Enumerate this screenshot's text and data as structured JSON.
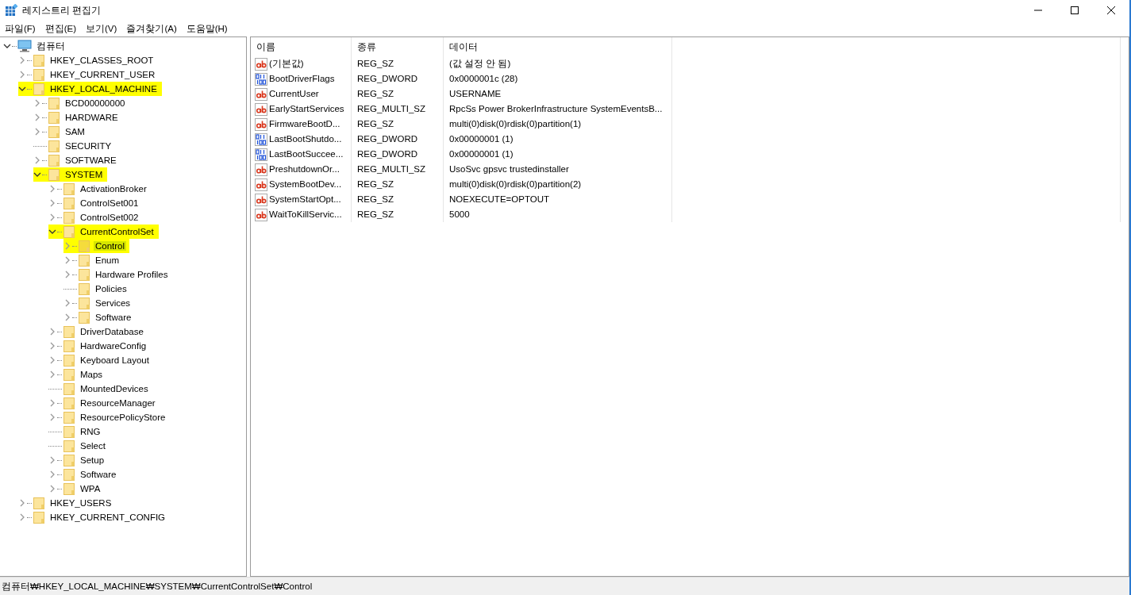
{
  "window": {
    "title": "레지스트리 편집기"
  },
  "menu": [
    "파일(F)",
    "편집(E)",
    "보기(V)",
    "즐겨찾기(A)",
    "도움말(H)"
  ],
  "tree": {
    "label": "컴퓨터",
    "kind": "computer",
    "expanded": true,
    "has_children": true,
    "highlighted": false,
    "selected": false,
    "children": [
      {
        "label": "HKEY_CLASSES_ROOT",
        "has_children": true,
        "highlighted": false,
        "selected": false
      },
      {
        "label": "HKEY_CURRENT_USER",
        "has_children": true,
        "highlighted": false,
        "selected": false
      },
      {
        "label": "HKEY_LOCAL_MACHINE",
        "has_children": true,
        "expanded": true,
        "highlighted": true,
        "selected": false,
        "children": [
          {
            "label": "BCD00000000",
            "has_children": true,
            "highlighted": false,
            "selected": false
          },
          {
            "label": "HARDWARE",
            "has_children": true,
            "highlighted": false,
            "selected": false
          },
          {
            "label": "SAM",
            "has_children": true,
            "highlighted": false,
            "selected": false
          },
          {
            "label": "SECURITY",
            "has_children": false,
            "highlighted": false,
            "selected": false
          },
          {
            "label": "SOFTWARE",
            "has_children": true,
            "highlighted": false,
            "selected": false
          },
          {
            "label": "SYSTEM",
            "has_children": true,
            "expanded": true,
            "highlighted": true,
            "selected": false,
            "children": [
              {
                "label": "ActivationBroker",
                "has_children": true,
                "highlighted": false,
                "selected": false
              },
              {
                "label": "ControlSet001",
                "has_children": true,
                "highlighted": false,
                "selected": false
              },
              {
                "label": "ControlSet002",
                "has_children": true,
                "highlighted": false,
                "selected": false
              },
              {
                "label": "CurrentControlSet",
                "has_children": true,
                "expanded": true,
                "highlighted": true,
                "selected": false,
                "children": [
                  {
                    "label": "Control",
                    "has_children": true,
                    "highlighted": true,
                    "selected": true
                  },
                  {
                    "label": "Enum",
                    "has_children": true,
                    "highlighted": false,
                    "selected": false
                  },
                  {
                    "label": "Hardware Profiles",
                    "has_children": true,
                    "highlighted": false,
                    "selected": false
                  },
                  {
                    "label": "Policies",
                    "has_children": false,
                    "highlighted": false,
                    "selected": false
                  },
                  {
                    "label": "Services",
                    "has_children": true,
                    "highlighted": false,
                    "selected": false
                  },
                  {
                    "label": "Software",
                    "has_children": true,
                    "highlighted": false,
                    "selected": false
                  }
                ]
              },
              {
                "label": "DriverDatabase",
                "has_children": true,
                "highlighted": false,
                "selected": false
              },
              {
                "label": "HardwareConfig",
                "has_children": true,
                "highlighted": false,
                "selected": false
              },
              {
                "label": "Keyboard Layout",
                "has_children": true,
                "highlighted": false,
                "selected": false
              },
              {
                "label": "Maps",
                "has_children": true,
                "highlighted": false,
                "selected": false
              },
              {
                "label": "MountedDevices",
                "has_children": false,
                "highlighted": false,
                "selected": false
              },
              {
                "label": "ResourceManager",
                "has_children": true,
                "highlighted": false,
                "selected": false
              },
              {
                "label": "ResourcePolicyStore",
                "has_children": true,
                "highlighted": false,
                "selected": false
              },
              {
                "label": "RNG",
                "has_children": false,
                "highlighted": false,
                "selected": false
              },
              {
                "label": "Select",
                "has_children": false,
                "highlighted": false,
                "selected": false
              },
              {
                "label": "Setup",
                "has_children": true,
                "highlighted": false,
                "selected": false
              },
              {
                "label": "Software",
                "has_children": true,
                "highlighted": false,
                "selected": false
              },
              {
                "label": "WPA",
                "has_children": true,
                "highlighted": false,
                "selected": false
              }
            ]
          }
        ]
      },
      {
        "label": "HKEY_USERS",
        "has_children": true,
        "highlighted": false,
        "selected": false
      },
      {
        "label": "HKEY_CURRENT_CONFIG",
        "has_children": true,
        "highlighted": false,
        "selected": false
      }
    ]
  },
  "columns": [
    "이름",
    "종류",
    "데이터"
  ],
  "values": [
    {
      "kind": "string",
      "name": "(기본값)",
      "type": "REG_SZ",
      "data": "(값 설정 안 됨)"
    },
    {
      "kind": "binary",
      "name": "BootDriverFlags",
      "type": "REG_DWORD",
      "data": "0x0000001c (28)"
    },
    {
      "kind": "string",
      "name": "CurrentUser",
      "type": "REG_SZ",
      "data": "USERNAME"
    },
    {
      "kind": "string",
      "name": "EarlyStartServices",
      "type": "REG_MULTI_SZ",
      "data": "RpcSs Power BrokerInfrastructure SystemEventsB..."
    },
    {
      "kind": "string",
      "name": "FirmwareBootD...",
      "type": "REG_SZ",
      "data": "multi(0)disk(0)rdisk(0)partition(1)"
    },
    {
      "kind": "binary",
      "name": "LastBootShutdo...",
      "type": "REG_DWORD",
      "data": "0x00000001 (1)"
    },
    {
      "kind": "binary",
      "name": "LastBootSuccee...",
      "type": "REG_DWORD",
      "data": "0x00000001 (1)"
    },
    {
      "kind": "string",
      "name": "PreshutdownOr...",
      "type": "REG_MULTI_SZ",
      "data": "UsoSvc gpsvc trustedinstaller"
    },
    {
      "kind": "string",
      "name": "SystemBootDev...",
      "type": "REG_SZ",
      "data": "multi(0)disk(0)rdisk(0)partition(2)"
    },
    {
      "kind": "string",
      "name": "SystemStartOpt...",
      "type": "REG_SZ",
      "data": " NOEXECUTE=OPTOUT"
    },
    {
      "kind": "string",
      "name": "WaitToKillServic...",
      "type": "REG_SZ",
      "data": "5000"
    }
  ],
  "status_bar": "컴퓨터₩HKEY_LOCAL_MACHINE₩SYSTEM₩CurrentControlSet₩Control"
}
